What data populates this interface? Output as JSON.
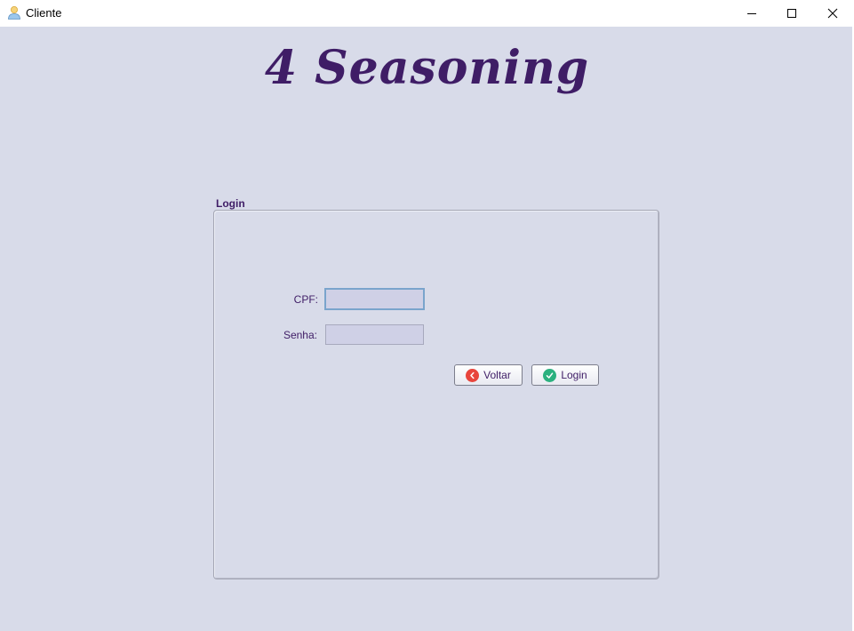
{
  "window": {
    "title": "Cliente",
    "controls": [
      "minimize",
      "maximize",
      "close"
    ]
  },
  "app": {
    "logo_text": "4 Seasoning"
  },
  "login_panel": {
    "title": "Login",
    "cpf_label": "CPF:",
    "cpf_value": "",
    "senha_label": "Senha:",
    "senha_value": "",
    "back_button_label": "Voltar",
    "back_button_icon": "chevron-left-icon",
    "login_button_label": "Login",
    "login_button_icon": "check-icon"
  },
  "colors": {
    "background": "#d8dbe9",
    "accent_text": "#3f1d66",
    "field_background": "#cfd0e6",
    "focus_border": "#7aa4cc",
    "back_icon": "#e8453c",
    "login_icon": "#2bb17f"
  }
}
